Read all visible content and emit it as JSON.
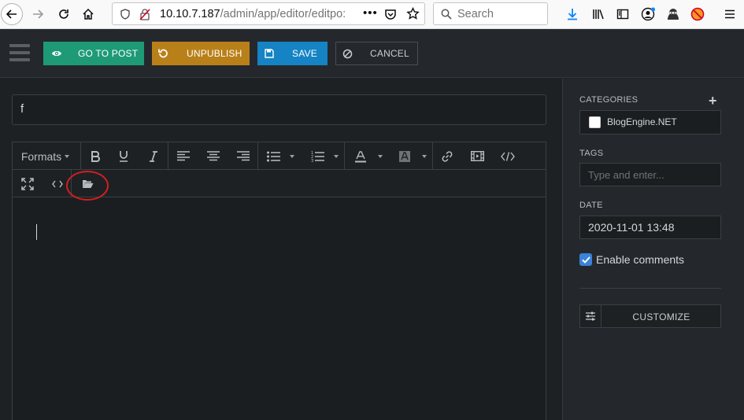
{
  "browser": {
    "url_host": "10.10.7.187",
    "url_path": "/admin/app/editor/editpo:",
    "search_placeholder": "Search"
  },
  "toolbar": {
    "go_to_post": "GO TO POST",
    "unpublish": "UNPUBLISH",
    "save": "SAVE",
    "cancel": "CANCEL"
  },
  "post": {
    "title": "f"
  },
  "editor": {
    "formats_label": "Formats"
  },
  "sidebar": {
    "categories_label": "CATEGORIES",
    "categories": [
      {
        "name": "BlogEngine.NET",
        "checked": false
      }
    ],
    "tags_label": "TAGS",
    "tags_placeholder": "Type and enter...",
    "date_label": "DATE",
    "date_value": "2020-11-01 13:48",
    "enable_comments_label": "Enable comments",
    "enable_comments_checked": true,
    "customize_label": "CUSTOMIZE"
  },
  "colors": {
    "go_to_post": "#1e9a77",
    "unpublish": "#b9801a",
    "save": "#1583c4",
    "highlight_circle": "#d41f1f"
  }
}
